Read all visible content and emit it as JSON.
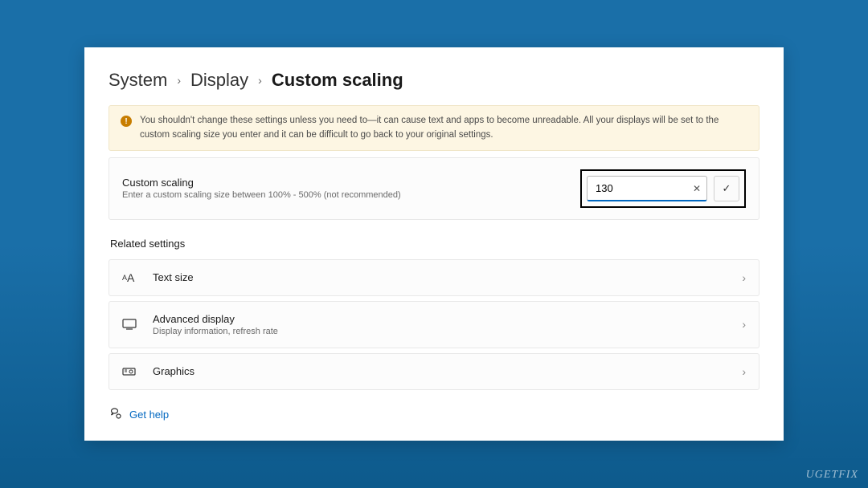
{
  "breadcrumb": {
    "level1": "System",
    "level2": "Display",
    "current": "Custom scaling"
  },
  "warning": {
    "text": "You shouldn't change these settings unless you need to—it can cause text and apps to become unreadable. All your displays will be set to the custom scaling size you enter and it can be difficult to go back to your original settings."
  },
  "custom_scaling": {
    "title": "Custom scaling",
    "subtitle": "Enter a custom scaling size between 100% - 500% (not recommended)",
    "value": "130"
  },
  "related": {
    "heading": "Related settings",
    "items": [
      {
        "title": "Text size",
        "subtitle": ""
      },
      {
        "title": "Advanced display",
        "subtitle": "Display information, refresh rate"
      },
      {
        "title": "Graphics",
        "subtitle": ""
      }
    ]
  },
  "help": {
    "label": "Get help"
  },
  "watermark": "UGETFIX"
}
